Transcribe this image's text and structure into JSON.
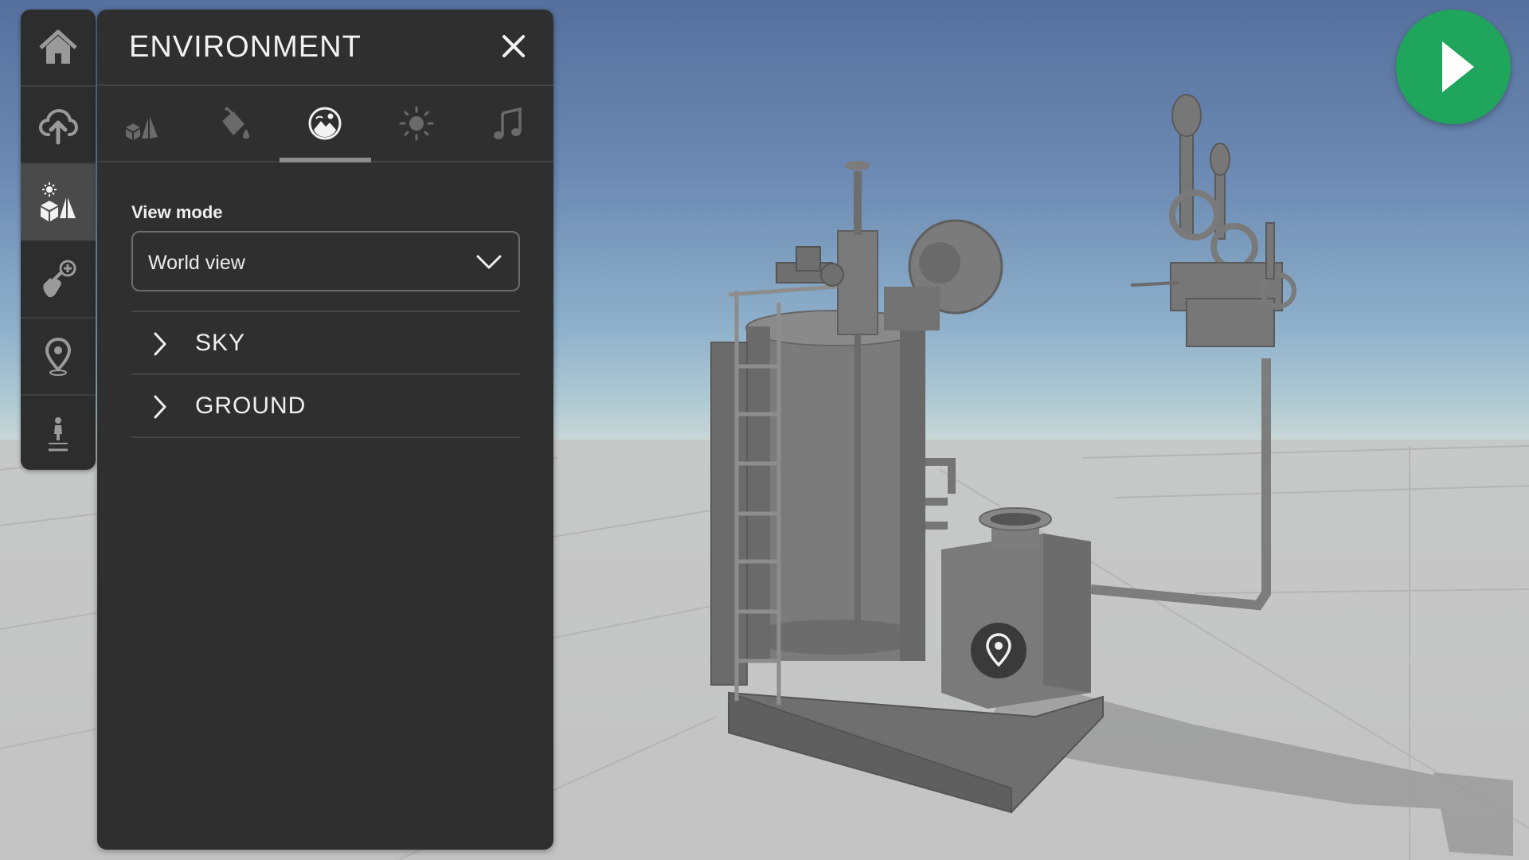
{
  "panel": {
    "title": "ENVIRONMENT",
    "tabs": [
      {
        "icon": "objects-icon",
        "active": false
      },
      {
        "icon": "paint-bucket-icon",
        "active": false
      },
      {
        "icon": "landscape-icon",
        "active": true
      },
      {
        "icon": "sun-icon",
        "active": false
      },
      {
        "icon": "music-note-icon",
        "active": false
      }
    ],
    "view_mode": {
      "label": "View mode",
      "selected": "World view"
    },
    "sections": [
      {
        "label": "SKY"
      },
      {
        "label": "GROUND"
      }
    ]
  },
  "rail": {
    "items": [
      {
        "icon": "home-icon",
        "active": false
      },
      {
        "icon": "cloud-upload-icon",
        "active": false
      },
      {
        "icon": "environment-icon",
        "active": true
      },
      {
        "icon": "add-interaction-icon",
        "active": false
      },
      {
        "icon": "location-pin-icon",
        "active": false
      },
      {
        "icon": "person-spawn-icon",
        "active": false
      }
    ]
  },
  "colors": {
    "panel_bg": "#2f2f2f",
    "play_button": "#1fa55c",
    "sky_top": "#55709d",
    "ground": "#c6c6c6"
  }
}
